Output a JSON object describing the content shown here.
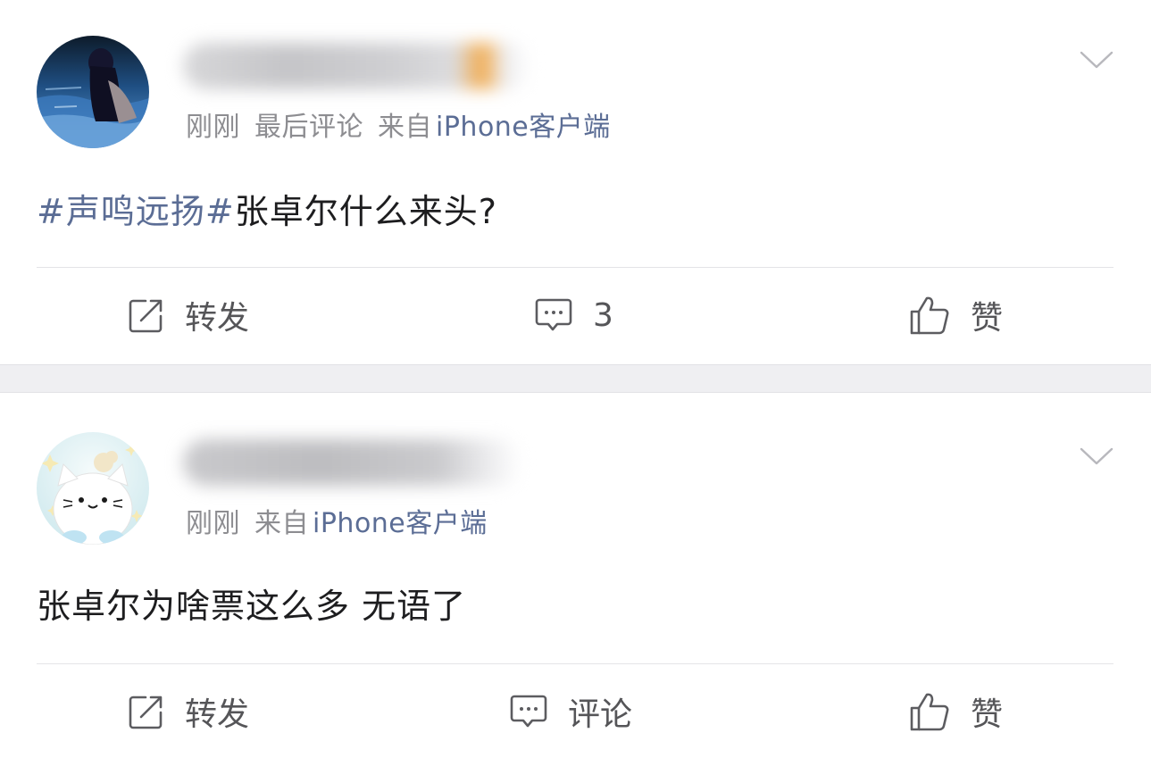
{
  "posts": [
    {
      "time": "刚刚",
      "last_comment": "最后评论",
      "from_prefix": "来自",
      "client": "iPhone客户端",
      "topic": "#声鸣远扬#",
      "text": "张卓尔什么来头?",
      "actions": {
        "repost": "转发",
        "comment": "3",
        "like": "赞"
      }
    },
    {
      "time": "刚刚",
      "from_prefix": "来自",
      "client": "iPhone客户端",
      "text": "张卓尔为啥票这么多 无语了",
      "actions": {
        "repost": "转发",
        "comment": "评论",
        "like": "赞"
      }
    }
  ],
  "icons": {
    "more": "chevron-down-icon",
    "repost": "share-icon",
    "comment": "comment-icon",
    "like": "thumbs-up-icon"
  },
  "colors": {
    "link": "#5b6d95",
    "meta": "#8d8d91",
    "text": "#1d1d1f",
    "action": "#555558",
    "separator": "#efeff2"
  }
}
